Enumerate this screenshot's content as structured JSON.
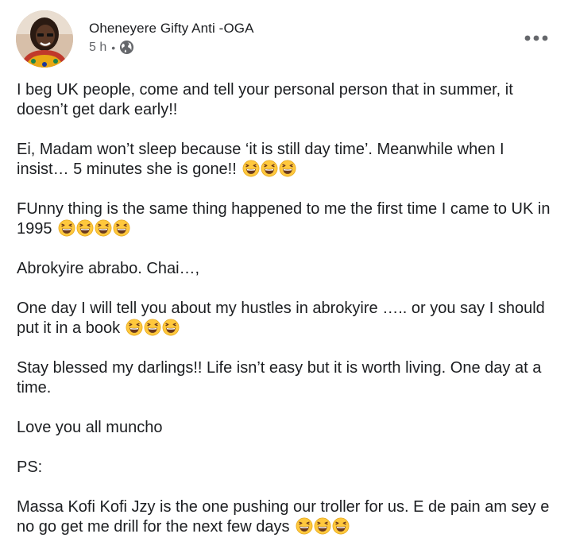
{
  "author": {
    "name": "Oheneyere Gifty Anti -OGA",
    "time": "5 h",
    "separator": "•",
    "privacy_icon": "globe-icon"
  },
  "menu": {
    "icon": "more-horizontal-icon"
  },
  "post": {
    "paragraphs": [
      {
        "text": "I beg UK people, come and tell your personal person that in summer, it doesn’t get dark early!!",
        "emoji_count": 0
      },
      {
        "text": "Ei, Madam won’t sleep because ‘it is still day time’.  Meanwhile when I insist… 5 minutes she is gone!!",
        "emoji_count": 3
      },
      {
        "text": "FUnny thing is the same thing happened to me the first time I came to UK in 1995",
        "emoji_count": 4
      },
      {
        "text": "Abrokyire abrabo. Chai…,",
        "emoji_count": 0
      },
      {
        "text": "One day I will tell you about my hustles in abrokyire ….. or you say I should put it in a book",
        "emoji_count": 3
      },
      {
        "text": "Stay blessed my darlings!!  Life isn’t easy but it is worth living.  One day at a time.",
        "emoji_count": 0
      },
      {
        "text": "Love you all muncho",
        "emoji_count": 0
      },
      {
        "text": "PS:",
        "emoji_count": 0
      },
      {
        "text": "Massa Kofi Kofi Jzy is the one pushing our troller for us.  E de pain am sey e no go get me drill for the next few days",
        "emoji_count": 3
      }
    ],
    "emoji_name": "grinning-squinting-face-emoji"
  },
  "colors": {
    "text": "#1c1e21",
    "meta": "#65676b",
    "emoji_face": "#ffc83d",
    "emoji_outline": "#e3a61b",
    "emoji_mouth": "#6b3a1e"
  }
}
